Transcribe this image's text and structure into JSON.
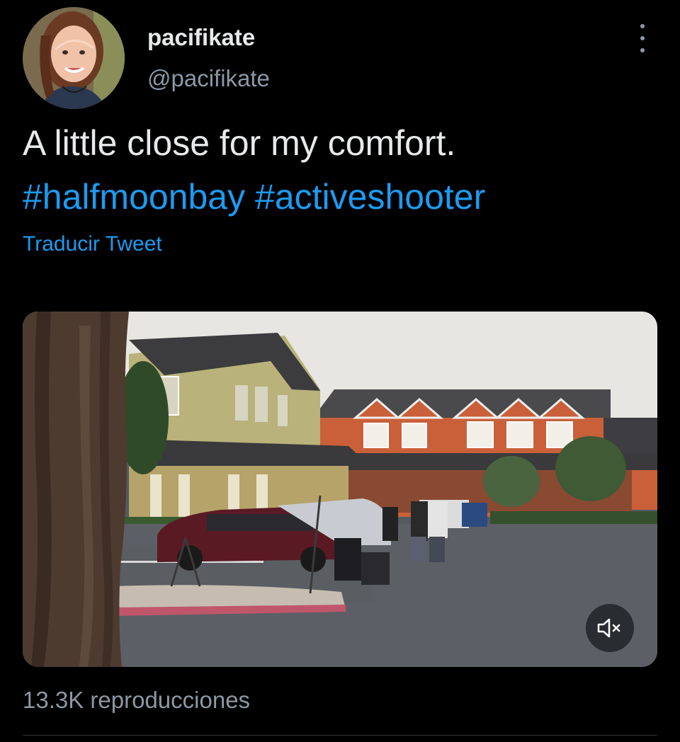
{
  "author": {
    "display_name": "pacifikate",
    "handle": "@pacifikate",
    "avatar_icon": "profile-photo"
  },
  "tweet": {
    "text": "A little close for my comfort.",
    "hashtags": [
      "#halfmoonbay",
      "#activeshooter"
    ],
    "translate_label": "Traducir Tweet"
  },
  "media": {
    "type": "video",
    "mute_icon": "speaker-muted-icon"
  },
  "stats": {
    "views": "13.3K reproducciones"
  },
  "colors": {
    "background": "#000000",
    "text": "#e7e9ea",
    "secondary": "#8b98a5",
    "link": "#1d9bf0"
  }
}
